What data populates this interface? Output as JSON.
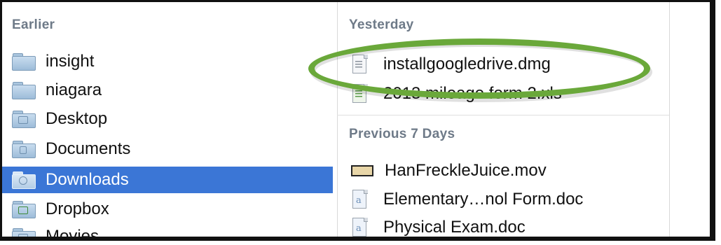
{
  "left_column": {
    "header": "Earlier",
    "items": [
      {
        "label": "insight",
        "icon": "folder-icon",
        "selected": false
      },
      {
        "label": "niagara",
        "icon": "folder-icon",
        "selected": false
      },
      {
        "label": "Desktop",
        "icon": "desktop-folder-icon",
        "selected": false
      },
      {
        "label": "Documents",
        "icon": "documents-folder-icon",
        "selected": false
      },
      {
        "label": "Downloads",
        "icon": "downloads-folder-icon",
        "selected": true
      },
      {
        "label": "Dropbox",
        "icon": "dropbox-folder-icon",
        "selected": false
      },
      {
        "label": "Movies",
        "icon": "movies-folder-icon",
        "selected": false
      }
    ]
  },
  "right_column": {
    "yesterday_header": "Yesterday",
    "yesterday_items": [
      {
        "label": "installgoogledrive.dmg",
        "icon": "disk-image-icon"
      },
      {
        "label": "2013 mileage form 2.xls",
        "icon": "spreadsheet-icon"
      }
    ],
    "previous_header": "Previous 7 Days",
    "previous_items": [
      {
        "label": "HanFreckleJuice.mov",
        "icon": "movie-file-icon"
      },
      {
        "label": "Elementary…nol Form.doc",
        "icon": "word-document-icon"
      },
      {
        "label": "Physical Exam.doc",
        "icon": "word-document-icon"
      }
    ]
  },
  "colors": {
    "selection": "#3b76d6",
    "highlight_ring": "#6aa83a",
    "section_header": "#6e7a88"
  }
}
